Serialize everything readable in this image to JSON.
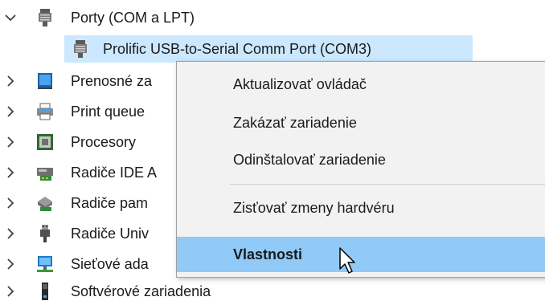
{
  "tree": {
    "ports_category": {
      "label": "Porty (COM a LPT)",
      "icon": "port-connector-icon",
      "expanded": true
    },
    "ports_child": {
      "label": "Prolific USB-to-Serial Comm Port (COM3)",
      "icon": "port-connector-icon",
      "selected": true
    },
    "categories": [
      {
        "label": "Prenosné za",
        "icon": "portable-device-icon"
      },
      {
        "label": "Print queue",
        "icon": "printer-icon"
      },
      {
        "label": "Procesory",
        "icon": "processor-icon"
      },
      {
        "label": "Radiče IDE A",
        "icon": "ide-controller-icon"
      },
      {
        "label": "Radiče pam",
        "icon": "storage-controller-icon"
      },
      {
        "label": "Radiče Univ",
        "icon": "usb-controller-icon"
      },
      {
        "label": "Sieťové ada",
        "icon": "network-adapter-icon"
      },
      {
        "label": "Softvérové zariadenia",
        "icon": "software-device-icon"
      }
    ]
  },
  "context_menu": {
    "items": [
      {
        "label": "Aktualizovať ovládač"
      },
      {
        "label": "Zakázať zariadenie"
      },
      {
        "label": "Odinštalovať zariadenie"
      },
      {
        "label": "Zisťovať zmeny hardvéru"
      },
      {
        "label": "Vlastnosti",
        "bold": true,
        "highlighted": true
      }
    ]
  },
  "colors": {
    "selection": "#cce8ff",
    "menu_background": "#f2f2f2",
    "menu_highlight": "#91c9f7"
  }
}
